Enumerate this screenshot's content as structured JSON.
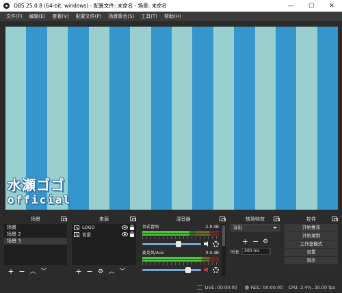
{
  "window": {
    "title": "OBS 25.0.8 (64-bit, windows) - 配置文件: 未命名 - 场景: 未命名"
  },
  "menu": [
    "文件(F)",
    "编辑(E)",
    "查看(V)",
    "配置文件(P)",
    "场景集合(S)",
    "工具(T)",
    "帮助(H)"
  ],
  "preview": {
    "stripe_colors": [
      "#9acfd0",
      "#3596cd"
    ],
    "stripe_count": 16,
    "overlay_line1": "水瀬ゴゴ",
    "overlay_line2": "official"
  },
  "scenes": {
    "title": "场景",
    "items": [
      "场景",
      "场景 2",
      "场景 3"
    ],
    "selected_index": 2
  },
  "sources": {
    "title": "来源",
    "items": [
      {
        "name": "LOGO"
      },
      {
        "name": "背景"
      }
    ]
  },
  "mixer": {
    "title": "混音器",
    "channels": [
      {
        "name": "台式音响",
        "db": "-2.8 dB",
        "level": 0.62,
        "muted": false
      },
      {
        "name": "麦克风/Aux",
        "db": "0.0 dB",
        "level": 0.78,
        "muted": true
      }
    ]
  },
  "transitions": {
    "title": "转场特效",
    "selected": "淡出",
    "duration_label": "时长",
    "duration_value": "300 ms"
  },
  "controls": {
    "title": "控件",
    "buttons": [
      "开始推流",
      "开始录制",
      "工作室模式",
      "设置",
      "退出"
    ]
  },
  "status": {
    "live_label": "LIVE:",
    "live_time": "00:00:00",
    "rec_label": "REC:",
    "rec_time": "00:00:00",
    "cpu": "CPU: 3.4%, 30.00 fps"
  },
  "colors": {
    "accent": "#7da4d6",
    "panel": "#2b2b2b",
    "list": "#1e1e1e",
    "mute_red": "#d43232"
  }
}
